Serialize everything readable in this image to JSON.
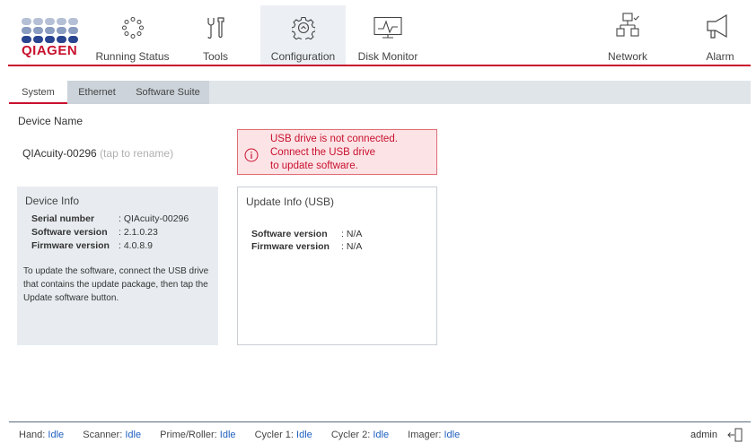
{
  "brand": {
    "wordmark": "QIAGEN",
    "dot_colors": [
      "#aab6cf",
      "#8fa2c3",
      "#2a4590",
      "#1b3380"
    ]
  },
  "nav": {
    "running_status": "Running Status",
    "tools": "Tools",
    "configuration": "Configuration",
    "disk_monitor": "Disk Monitor",
    "network": "Network",
    "alarm": "Alarm",
    "active": "Configuration"
  },
  "tabs": [
    {
      "label": "System",
      "active": true
    },
    {
      "label": "Ethernet",
      "active": false
    },
    {
      "label": "Software Suite",
      "active": false
    }
  ],
  "device": {
    "label": "Device Name",
    "name": "QIAcuity-00296",
    "rename_hint": "(tap to rename)"
  },
  "alert": {
    "line1": "USB drive is not connected.",
    "line2": "Connect the USB drive",
    "line3": "to update software.",
    "color": "#c8102e"
  },
  "device_info": {
    "title": "Device Info",
    "rows": [
      {
        "key": "Serial number",
        "value": ": QIAcuity-00296"
      },
      {
        "key": "Software version",
        "value": ": 2.1.0.23"
      },
      {
        "key": "Firmware version",
        "value": ": 4.0.8.9"
      }
    ],
    "help_text": "To update the software, connect the USB drive that contains the update package, then tap the Update software button."
  },
  "update_info": {
    "title": "Update Info (USB)",
    "rows": [
      {
        "key": "Software version",
        "value": ": N/A"
      },
      {
        "key": "Firmware version",
        "value": ": N/A"
      }
    ]
  },
  "status": [
    {
      "label": "Hand: ",
      "value": "Idle"
    },
    {
      "label": "Scanner: ",
      "value": "Idle"
    },
    {
      "label": "Prime/Roller: ",
      "value": "Idle"
    },
    {
      "label": "Cycler 1: ",
      "value": "Idle"
    },
    {
      "label": "Cycler 2: ",
      "value": "Idle"
    },
    {
      "label": "Imager: ",
      "value": "Idle"
    }
  ],
  "user": "admin",
  "icons": {
    "running_status": "dots-circle-icon",
    "tools": "wrench-screwdriver-icon",
    "configuration": "gear-icon",
    "disk_monitor": "monitor-graph-icon",
    "network": "network-icon",
    "alarm": "megaphone-icon",
    "alert": "info-circle-icon",
    "logout": "logout-icon"
  }
}
